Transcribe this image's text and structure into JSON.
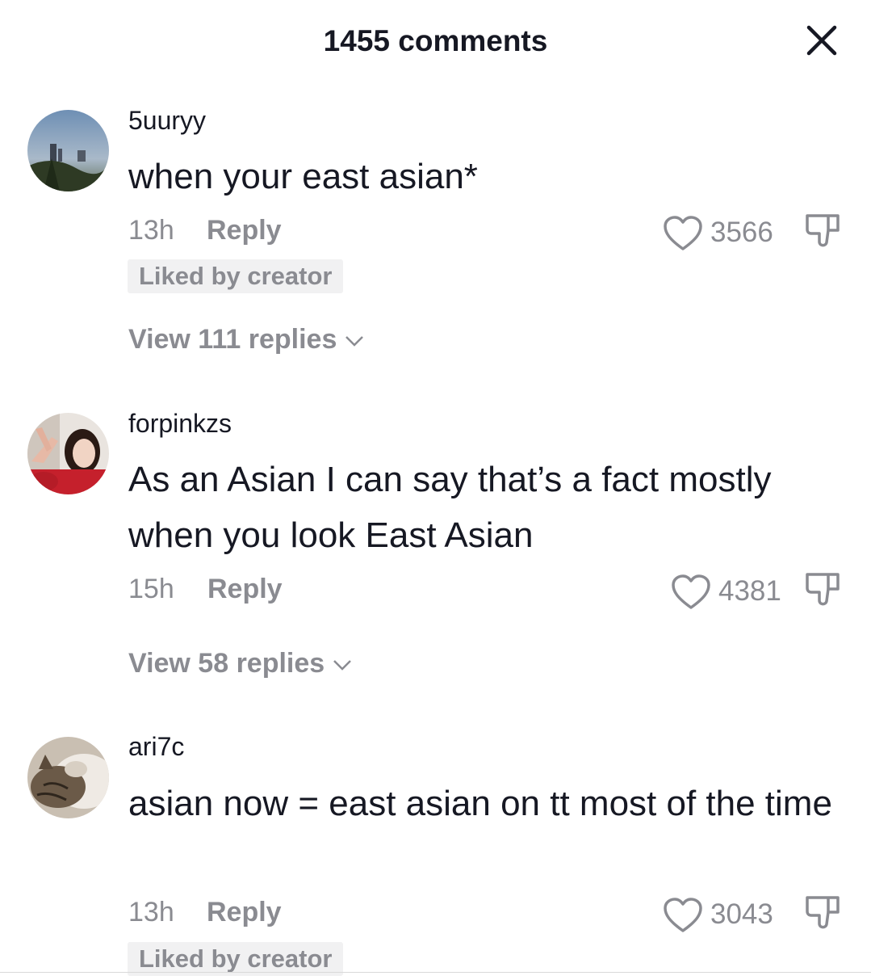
{
  "header": {
    "title": "1455 comments",
    "close_icon": "close-icon"
  },
  "colors": {
    "text_primary": "#161823",
    "text_secondary": "#8a8b91",
    "badge_bg": "#f1f1f2"
  },
  "comments": [
    {
      "username": "5uuryy",
      "text": "when your east asian*",
      "time": "13h",
      "reply_label": "Reply",
      "likes": "3566",
      "badge": "Liked by creator",
      "view_replies": "View 111 replies",
      "avatar_icon": "avatar-photo-cityscape"
    },
    {
      "username": "forpinkzs",
      "text": "As an Asian I can say that’s a fact mostly when you look East Asian",
      "time": "15h",
      "reply_label": "Reply",
      "likes": "4381",
      "view_replies": "View 58 replies",
      "avatar_icon": "avatar-photo-person"
    },
    {
      "username": "ari7c",
      "text": "asian now = east asian on tt most of the time",
      "time": "13h",
      "reply_label": "Reply",
      "likes": "3043",
      "badge": "Liked by creator",
      "avatar_icon": "avatar-photo-cat"
    }
  ]
}
